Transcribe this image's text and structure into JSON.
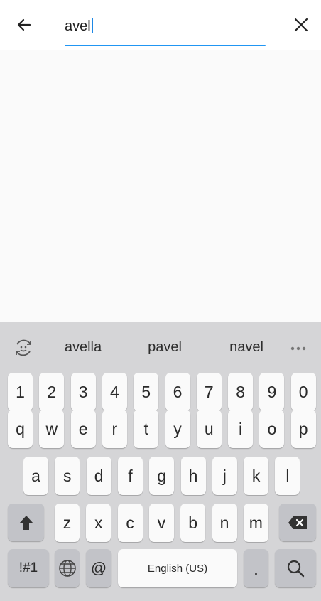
{
  "search": {
    "value": "avel",
    "back_icon": "arrow-left-icon",
    "clear_icon": "close-icon",
    "underline_color": "#2196f3"
  },
  "keyboard": {
    "suggestions": [
      "avella",
      "pavel",
      "navel"
    ],
    "emoji_icon": "emoji-cycle-icon",
    "more_icon": "more-horizontal-icon",
    "number_row": [
      "1",
      "2",
      "3",
      "4",
      "5",
      "6",
      "7",
      "8",
      "9",
      "0"
    ],
    "row1": [
      "q",
      "w",
      "e",
      "r",
      "t",
      "y",
      "u",
      "i",
      "o",
      "p"
    ],
    "row2": [
      "a",
      "s",
      "d",
      "f",
      "g",
      "h",
      "j",
      "k",
      "l"
    ],
    "row3": [
      "z",
      "x",
      "c",
      "v",
      "b",
      "n",
      "m"
    ],
    "shift_icon": "shift-arrow-icon",
    "backspace_icon": "backspace-icon",
    "symbols_label": "!#1",
    "language_icon": "globe-icon",
    "at_label": "@",
    "space_label": "English (US)",
    "period_label": ".",
    "search_icon": "search-icon"
  }
}
